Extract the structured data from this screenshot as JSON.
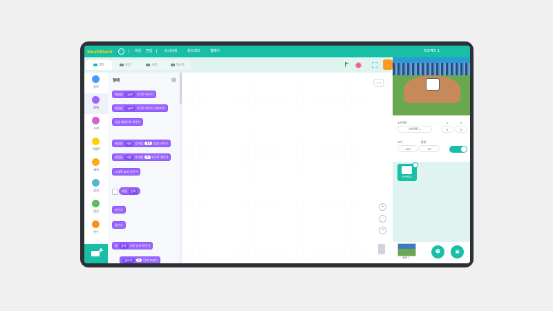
{
  "app": {
    "logo_text": "NextBlock",
    "project_title": "프로젝트 1"
  },
  "topmenu": [
    {
      "label": "파일"
    },
    {
      "label": "편집"
    },
    {
      "label": "모니터링"
    },
    {
      "label": "레드메이"
    },
    {
      "label": "웹페이"
    }
  ],
  "tabs": [
    {
      "label": "코드",
      "active": true
    },
    {
      "label": "모양",
      "active": false
    },
    {
      "label": "소리",
      "active": false
    },
    {
      "label": "텍스트",
      "active": false
    }
  ],
  "categories": [
    {
      "label": "동작",
      "color": "#4c97ff"
    },
    {
      "label": "형태",
      "color": "#9966ff"
    },
    {
      "label": "소리",
      "color": "#cf63cf"
    },
    {
      "label": "이벤트",
      "color": "#ffcf0b"
    },
    {
      "label": "제어",
      "color": "#ffab19"
    },
    {
      "label": "감지",
      "color": "#5cb1d6"
    },
    {
      "label": "연산",
      "color": "#59c059"
    },
    {
      "label": "변수",
      "color": "#ff8c1a"
    }
  ],
  "palette": {
    "heading": "형태",
    "blocks": {
      "b1": {
        "pre": "배경을",
        "dd": "Light",
        "post": "(으)로 바꾸기"
      },
      "b2": {
        "pre": "배경을",
        "dd": "Light",
        "post": "(으)로 바꾸기 기다리기"
      },
      "b3": {
        "text": "다음 배경으로 바꾸기"
      },
      "b4": {
        "pre": "배경을",
        "dd": "색깔",
        "mid": "효과를",
        "num": "25",
        "post": "만큼 바꾸기"
      },
      "b5": {
        "pre": "배경을",
        "dd": "색깔",
        "mid": "효과를",
        "num": "0",
        "post": "(으)로 정하기"
      },
      "b6": {
        "text": "그래픽 효과 지우기"
      },
      "b7": {
        "pre": "배경",
        "dd": "번호"
      },
      "b8": {
        "text": "보이기"
      },
      "b9": {
        "text": "숨기기"
      },
      "b10": {
        "pre": "맨",
        "dd": "앞쪽",
        "post": "으로 순서 바꾸기"
      },
      "b11": {
        "dd": "앞으로",
        "num": "1",
        "post": "단계 보내기"
      }
    }
  },
  "sprite_info": {
    "label_sprite": "오브젝트",
    "sprite_name": "오브젝트 1",
    "label_x": "x",
    "label_y": "y",
    "x": "0",
    "y": "0",
    "label_size": "크기",
    "label_direction": "방향",
    "size": "100",
    "direction": "90"
  },
  "sprites": [
    {
      "name": "오브젝트1"
    }
  ],
  "stage": {
    "backdrop_label": "배경 1"
  },
  "colors": {
    "accent": "#16bfa6",
    "looks": "#9966ff",
    "orange": "#ff9a1f",
    "stop": "#f2627a"
  },
  "icons": [
    "globe-icon",
    "green-flag-icon",
    "stop-icon",
    "fullscreen-icon",
    "zoom-in-icon",
    "zoom-out-icon",
    "zoom-reset-icon",
    "trash-icon",
    "add-sprite-icon",
    "add-backdrop-icon",
    "add-extension-icon",
    "help-icon"
  ]
}
